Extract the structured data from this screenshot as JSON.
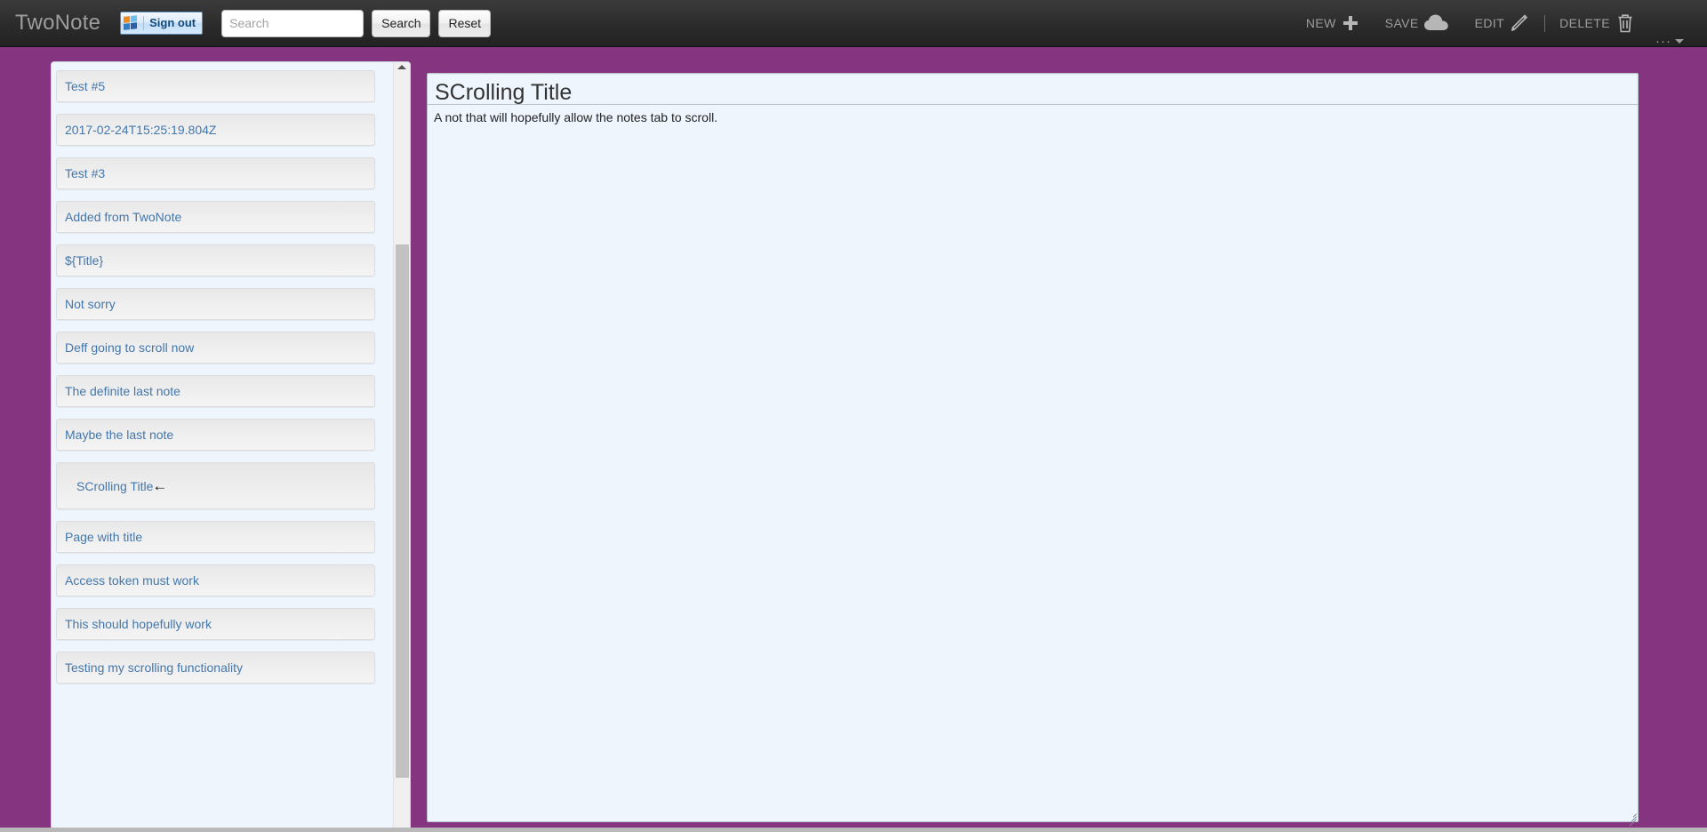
{
  "app": {
    "brand": "TwoNote",
    "background_color": "#85357f",
    "header_color": "#2b2b2b",
    "link_color": "#4477aa"
  },
  "header": {
    "signout_label": "Sign out",
    "signout_icon": "windows-logo-icon",
    "search": {
      "placeholder": "Search",
      "value": "",
      "search_button": "Search",
      "reset_button": "Reset"
    },
    "tools": [
      {
        "label": "NEW",
        "icon": "plus-icon"
      },
      {
        "label": "SAVE",
        "icon": "cloud-icon"
      },
      {
        "label": "EDIT",
        "icon": "pencil-icon"
      },
      {
        "label": "DELETE",
        "icon": "trash-icon"
      }
    ],
    "more_dots": "···"
  },
  "sidebar": {
    "selected_index": 9,
    "selected_marker": "←",
    "scrollbar": {
      "up_arrow_icon": "scroll-up-arrow-icon"
    },
    "items": [
      {
        "title": "Test #5"
      },
      {
        "title": "2017-02-24T15:25:19.804Z"
      },
      {
        "title": "Test #3"
      },
      {
        "title": "Added from TwoNote"
      },
      {
        "title": "${Title}"
      },
      {
        "title": "Not sorry"
      },
      {
        "title": "Deff going to scroll now"
      },
      {
        "title": "The definite last note"
      },
      {
        "title": "Maybe the last note"
      },
      {
        "title": "SCrolling Title"
      },
      {
        "title": "Page with title"
      },
      {
        "title": "Access token must work"
      },
      {
        "title": "This should hopefully work"
      },
      {
        "title": "Testing my scrolling functionality"
      }
    ]
  },
  "note": {
    "title": "SCrolling Title",
    "title_placeholder": "Title",
    "body": "A not that will hopefully allow the notes tab to scroll.",
    "body_placeholder": "Note"
  }
}
